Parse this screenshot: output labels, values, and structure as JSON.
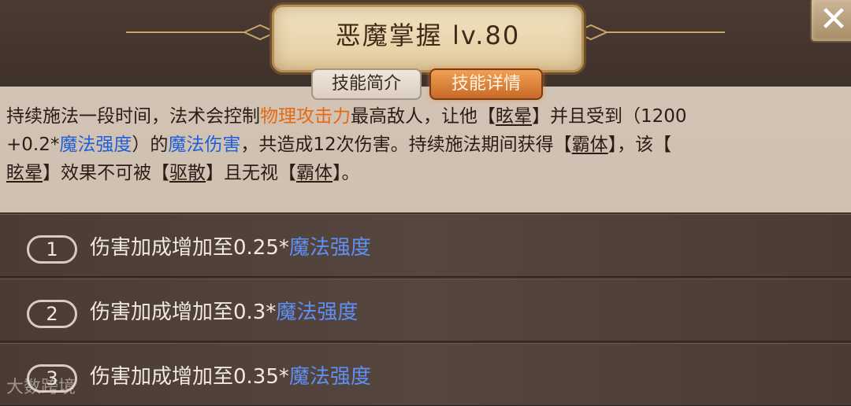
{
  "skill": {
    "title": "恶魔掌握 lv.80"
  },
  "tabs": {
    "intro_label": "技能简介",
    "detail_label": "技能详情"
  },
  "description": {
    "line1_a": "持续施法一段时间，法术会控制",
    "line1_b": "物理攻击力",
    "line1_c": "最高敌人，让他【",
    "line1_d": "眩晕",
    "line1_e": "】并且受到（1200",
    "line2_a": "+0.2*",
    "line2_b": "魔法强度",
    "line2_c": "）的",
    "line2_d": "魔法伤害",
    "line2_e": "，共造成12次伤害。持续施法期间获得【",
    "line2_f": "霸体",
    "line2_g": "】，该【",
    "line3_a": "眩晕",
    "line3_b": "】效果不可被【",
    "line3_c": "驱散",
    "line3_d": "】且无视【",
    "line3_e": "霸体",
    "line3_f": "】。"
  },
  "upgrades": [
    {
      "num": "1",
      "text": "伤害加成增加至0.25*",
      "stat": "魔法强度"
    },
    {
      "num": "2",
      "text": "伤害加成增加至0.3*",
      "stat": "魔法强度"
    },
    {
      "num": "3",
      "text": "伤害加成增加至0.35*",
      "stat": "魔法强度"
    }
  ],
  "watermark": "大数跨境",
  "colors": {
    "highlight_orange": "#e56a12",
    "highlight_blue": "#1f5fdc",
    "active_tab": "#d9782f"
  },
  "icons": {
    "close": "close-icon"
  }
}
